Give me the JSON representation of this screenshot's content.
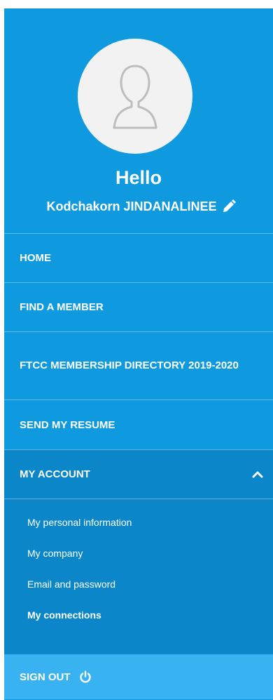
{
  "profile": {
    "greeting": "Hello",
    "name": "Kodchakorn JINDANALINEE",
    "avatar_icon": "user-silhouette-icon",
    "edit_icon": "pencil-icon"
  },
  "nav": {
    "home": "HOME",
    "find": "FIND A MEMBER",
    "directory": "FTCC MEMBERSHIP DIRECTORY 2019-2020",
    "resume": "SEND MY RESUME",
    "account": "MY ACCOUNT",
    "account_icon": "chevron-up-icon"
  },
  "submenu": {
    "items": [
      "My personal information",
      "My company",
      "Email and password",
      "My connections"
    ],
    "active": "My connections"
  },
  "signout": {
    "label": "SIGN OUT",
    "icon": "power-icon"
  },
  "colors": {
    "primary": "#0f9ae0",
    "account_bg": "#0a86c9",
    "signout_bg": "#38b2f0",
    "avatar_bg": "#f2f2f2"
  }
}
